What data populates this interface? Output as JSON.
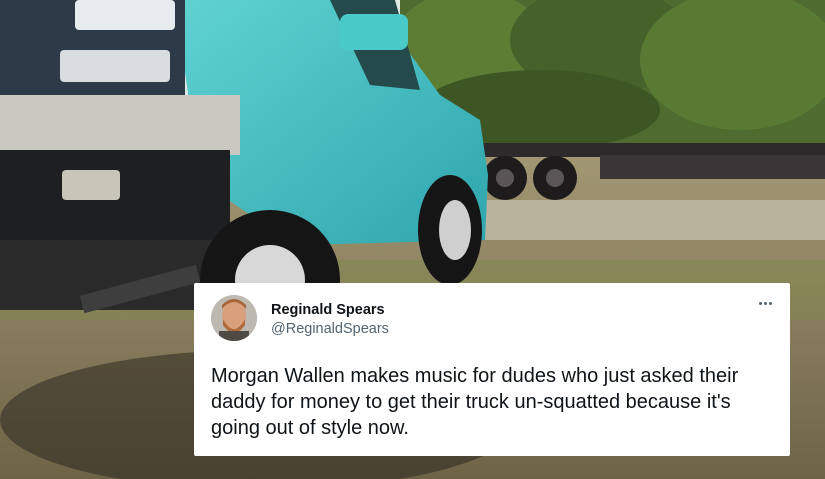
{
  "tweet": {
    "author_name": "Reginald Spears",
    "author_handle": "@ReginaldSpears",
    "text": "Morgan Wallen makes music for dudes who just asked their daddy for money to get their truck un-squatted because it's going out of style now.",
    "more_icon": "more-horizontal-icon"
  },
  "photo": {
    "subject_icon": "lifted-truck-photo",
    "colors": {
      "truck": "#45c2c4",
      "sky": "#dfe8e2",
      "trees": "#4f6b2f",
      "ground": "#8a7d5e",
      "trailer": "#2c2a2b"
    }
  }
}
